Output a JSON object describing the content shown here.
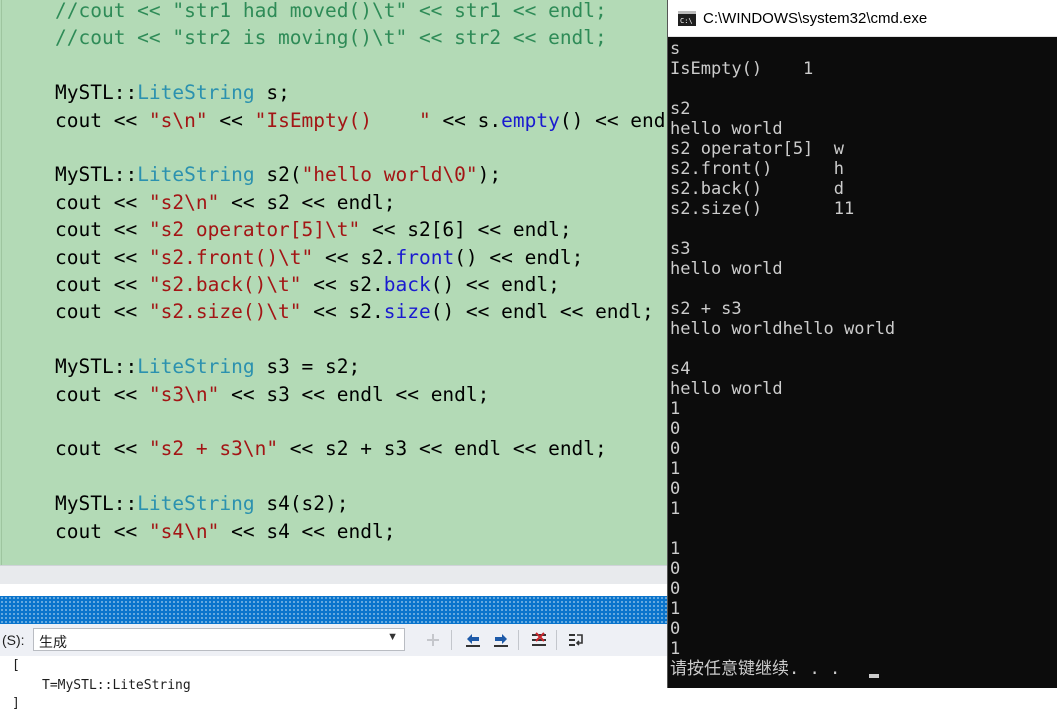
{
  "editor": {
    "lines": [
      [
        {
          "t": "//cout << \"str1 had moved()\\t\" << str1 << endl;",
          "c": "cmt"
        }
      ],
      [
        {
          "t": "//cout << \"str2 is moving()\\t\" << str2 << endl;",
          "c": "cmt"
        }
      ],
      [],
      [
        {
          "t": "MySTL::",
          "c": "txt"
        },
        {
          "t": "LiteString",
          "c": "type"
        },
        {
          "t": " s;",
          "c": "txt"
        }
      ],
      [
        {
          "t": "cout << ",
          "c": "txt"
        },
        {
          "t": "\"s\\n\"",
          "c": "str"
        },
        {
          "t": " << ",
          "c": "txt"
        },
        {
          "t": "\"IsEmpty()    \"",
          "c": "str"
        },
        {
          "t": " << s.",
          "c": "txt"
        },
        {
          "t": "empty",
          "c": "fn"
        },
        {
          "t": "() << endl << endl;",
          "c": "txt"
        }
      ],
      [],
      [
        {
          "t": "MySTL::",
          "c": "txt"
        },
        {
          "t": "LiteString",
          "c": "type"
        },
        {
          "t": " s2(",
          "c": "txt"
        },
        {
          "t": "\"hello world\\0\"",
          "c": "str"
        },
        {
          "t": ");",
          "c": "txt"
        }
      ],
      [
        {
          "t": "cout << ",
          "c": "txt"
        },
        {
          "t": "\"s2\\n\"",
          "c": "str"
        },
        {
          "t": " << s2 << endl;",
          "c": "txt"
        }
      ],
      [
        {
          "t": "cout << ",
          "c": "txt"
        },
        {
          "t": "\"s2 operator[5]\\t\"",
          "c": "str"
        },
        {
          "t": " << s2[6] << endl;",
          "c": "txt"
        }
      ],
      [
        {
          "t": "cout << ",
          "c": "txt"
        },
        {
          "t": "\"s2.front()\\t\"",
          "c": "str"
        },
        {
          "t": " << s2.",
          "c": "txt"
        },
        {
          "t": "front",
          "c": "fn"
        },
        {
          "t": "() << endl;",
          "c": "txt"
        }
      ],
      [
        {
          "t": "cout << ",
          "c": "txt"
        },
        {
          "t": "\"s2.back()\\t\"",
          "c": "str"
        },
        {
          "t": " << s2.",
          "c": "txt"
        },
        {
          "t": "back",
          "c": "fn"
        },
        {
          "t": "() << endl;",
          "c": "txt"
        }
      ],
      [
        {
          "t": "cout << ",
          "c": "txt"
        },
        {
          "t": "\"s2.size()\\t\"",
          "c": "str"
        },
        {
          "t": " << s2.",
          "c": "txt"
        },
        {
          "t": "size",
          "c": "fn"
        },
        {
          "t": "() << endl << endl;",
          "c": "txt"
        }
      ],
      [],
      [
        {
          "t": "MySTL::",
          "c": "txt"
        },
        {
          "t": "LiteString",
          "c": "type"
        },
        {
          "t": " s3 = s2;",
          "c": "txt"
        }
      ],
      [
        {
          "t": "cout << ",
          "c": "txt"
        },
        {
          "t": "\"s3\\n\"",
          "c": "str"
        },
        {
          "t": " << s3 << endl << endl;",
          "c": "txt"
        }
      ],
      [],
      [
        {
          "t": "cout << ",
          "c": "txt"
        },
        {
          "t": "\"s2 + s3\\n\"",
          "c": "str"
        },
        {
          "t": " << s2 + s3 << endl << endl;",
          "c": "txt"
        }
      ],
      [],
      [
        {
          "t": "MySTL::",
          "c": "txt"
        },
        {
          "t": "LiteString",
          "c": "type"
        },
        {
          "t": " s4(s2);",
          "c": "txt"
        }
      ],
      [
        {
          "t": "cout << ",
          "c": "txt"
        },
        {
          "t": "\"s4\\n\"",
          "c": "str"
        },
        {
          "t": " << s4 << endl;",
          "c": "txt"
        }
      ]
    ]
  },
  "output_panel": {
    "source_label": "(S):",
    "source_value": "生成",
    "lines": [
      "[",
      "T=MySTL::LiteString",
      "]"
    ]
  },
  "cmd": {
    "title": "C:\\WINDOWS\\system32\\cmd.exe",
    "lines": [
      "s",
      "IsEmpty()    1",
      "",
      "s2",
      "hello world",
      "s2 operator[5]  w",
      "s2.front()      h",
      "s2.back()       d",
      "s2.size()       11",
      "",
      "s3",
      "hello world",
      "",
      "s2 + s3",
      "hello worldhello world",
      "",
      "s4",
      "hello world",
      "1",
      "0",
      "0",
      "1",
      "0",
      "1",
      "",
      "1",
      "0",
      "0",
      "1",
      "0",
      "1",
      "请按任意键继续. . ."
    ]
  }
}
